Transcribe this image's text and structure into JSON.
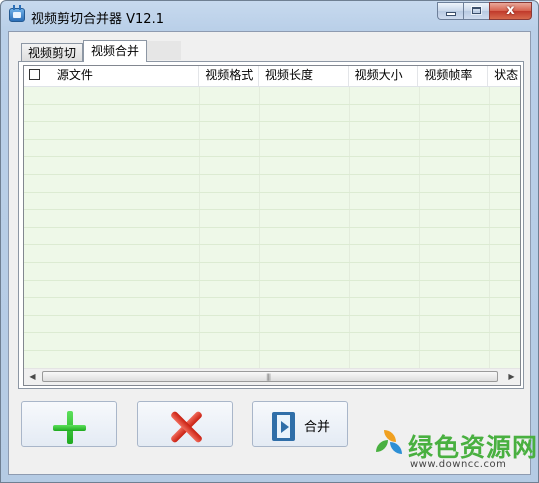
{
  "window": {
    "title": "视频剪切合并器 V12.1",
    "caption": {
      "close_glyph": "x"
    }
  },
  "tabs": [
    {
      "label": "视频剪切",
      "selected": false
    },
    {
      "label": "视频合并",
      "selected": true
    }
  ],
  "list": {
    "columns": [
      "源文件",
      "视频格式",
      "视频长度",
      "视频大小",
      "视频帧率",
      "状态"
    ],
    "select_all_checked": false,
    "rows": []
  },
  "scrollbar": {
    "left_arrow": "◀",
    "right_arrow": "▶",
    "grip": "|||"
  },
  "buttons": {
    "add_icon": "plus-icon",
    "delete_icon": "x-icon",
    "merge_label": "合并"
  },
  "watermark": {
    "brand": "绿色资源网",
    "url": "www.downcc.com"
  },
  "colors": {
    "list_background": "#eef8e8",
    "add_green": "#1ea91e",
    "delete_red": "#c81e10",
    "film_blue": "#2f6ea8",
    "watermark_green": "#49b040"
  }
}
